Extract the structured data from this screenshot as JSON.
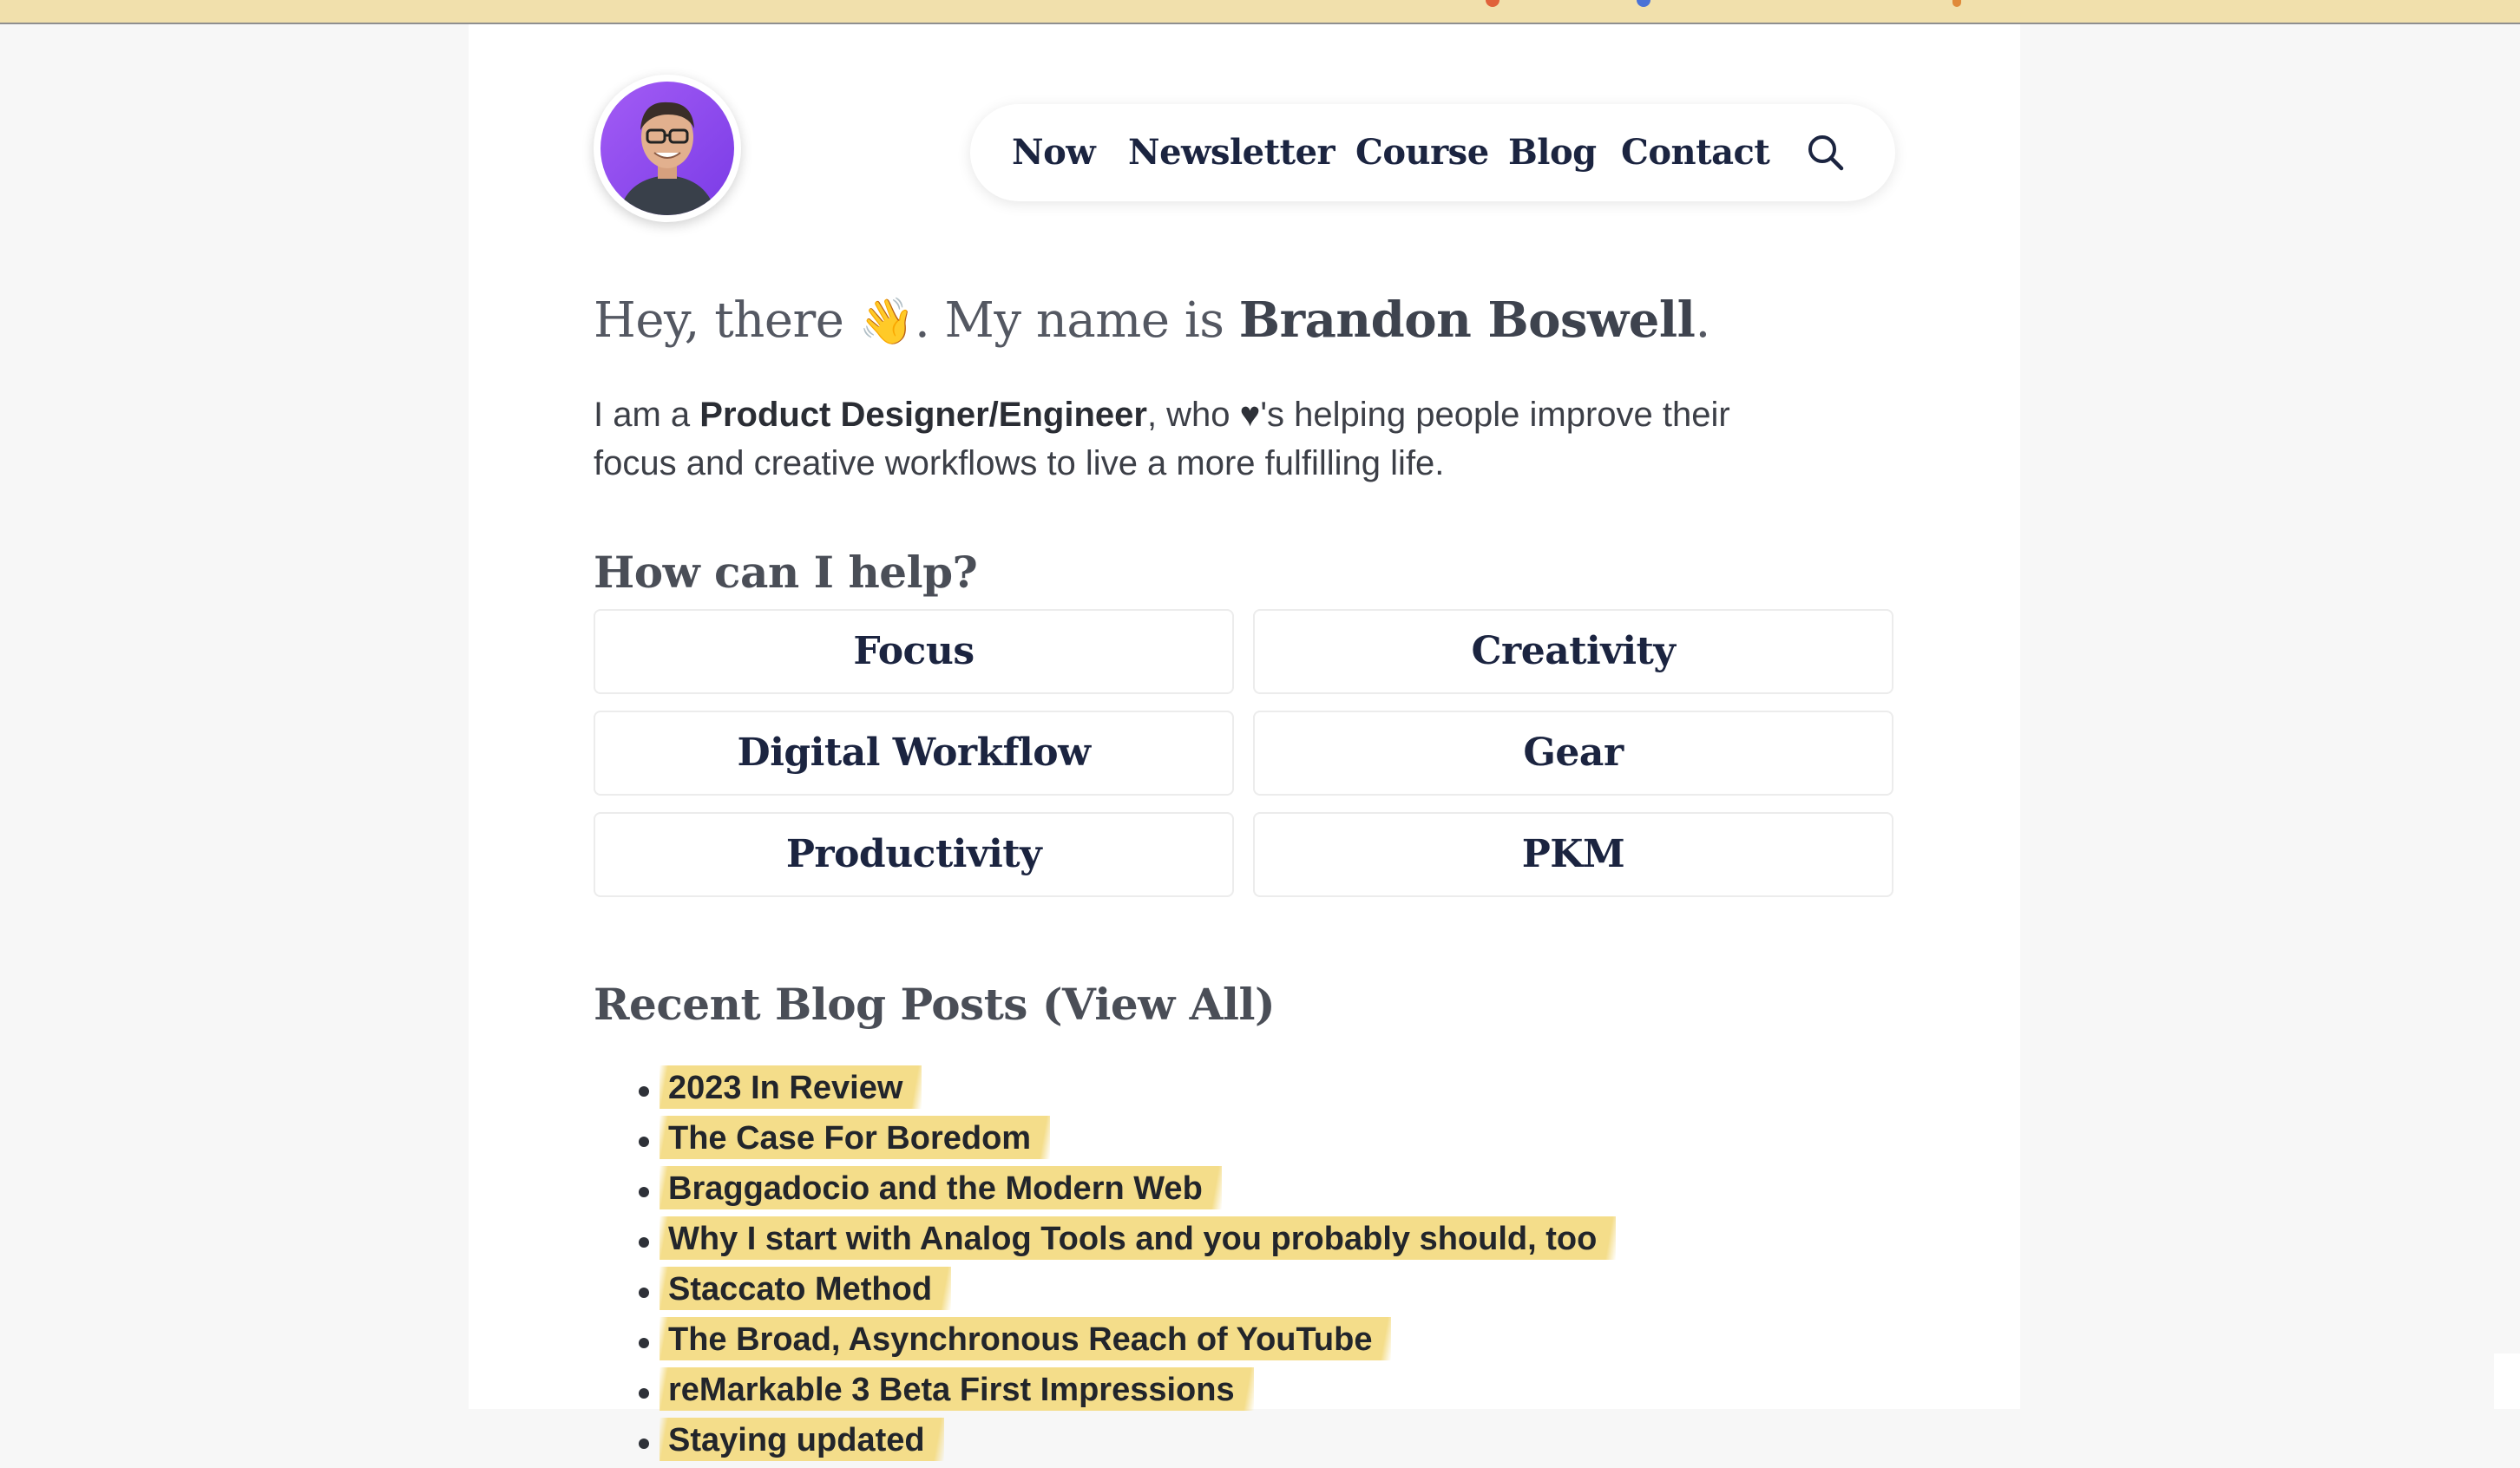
{
  "nav": {
    "items": [
      "Now",
      "Newsletter",
      "Course",
      "Blog",
      "Contact"
    ],
    "search_icon": "search-icon"
  },
  "hero": {
    "greeting": "Hey, there ",
    "wave_emoji": "👋",
    "middle": ". My name is ",
    "name": "Brandon Boswell",
    "end": "."
  },
  "intro": {
    "part1": "I am a ",
    "role": "Product Designer/Engineer",
    "part2": ", who ",
    "heart": "♥",
    "part3": "'s helping people improve their focus and creative workflows to live a more fulfilling life."
  },
  "help": {
    "title": "How can I help?",
    "topics": [
      "Focus",
      "Creativity",
      "Digital Workflow",
      "Gear",
      "Productivity",
      "PKM"
    ]
  },
  "recent": {
    "title": "Recent Blog Posts (View All)",
    "posts": [
      "2023 In Review",
      "The Case For Boredom",
      "Braggadocio and the Modern Web",
      "Why I start with Analog Tools and you probably should, too",
      "Staccato Method",
      "The Broad, Asynchronous Reach of YouTube",
      "reMarkable 3 Beta First Impressions",
      "Staying updated"
    ]
  },
  "colors": {
    "accent_highlight": "#f4dd8a",
    "nav_text": "#1b2440",
    "avatar_bg": "#8b4cf0"
  }
}
